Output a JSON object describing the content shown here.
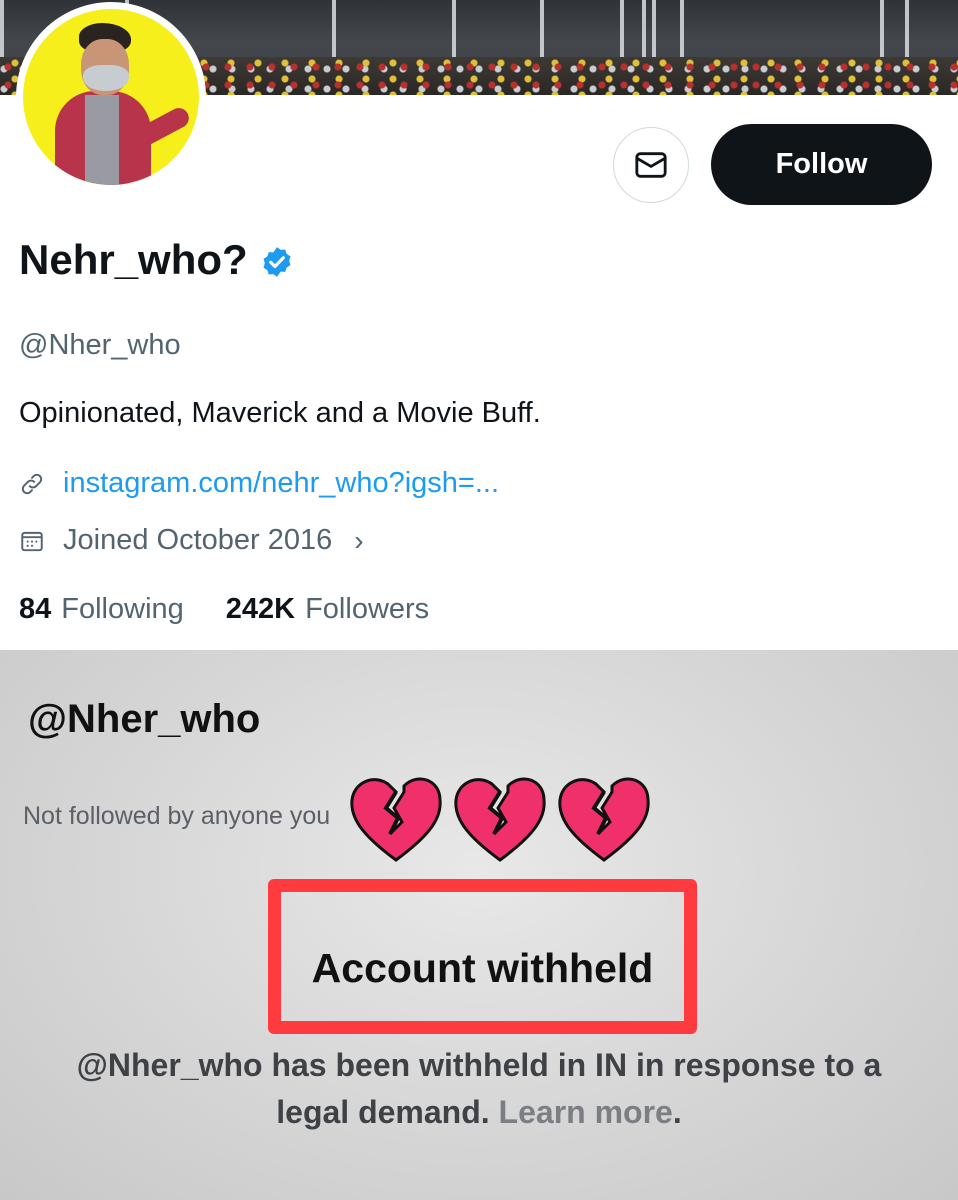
{
  "profile": {
    "display_name": "Nehr_who?",
    "handle": "@Nher_who",
    "bio": "Opinionated, Maverick and a Movie Buff.",
    "link": "instagram.com/nehr_who?igsh=...",
    "joined": "Joined October 2016",
    "following_count": "84",
    "following_label": "Following",
    "followers_count": "242K",
    "followers_label": "Followers",
    "verified": true
  },
  "actions": {
    "message_icon": "envelope-icon",
    "follow_label": "Follow"
  },
  "withheld": {
    "handle": "@Nher_who",
    "not_followed": "Not followed by anyone you",
    "title": "Account withheld",
    "description": "@Nher_who has been withheld in IN in response to a legal demand.",
    "learn_more": "Learn more",
    "trailing": ".",
    "overlay_emoji": [
      "broken-heart",
      "broken-heart",
      "broken-heart"
    ]
  },
  "colors": {
    "accent_link": "#1d9bf0",
    "follow_bg": "#0f1419",
    "verified": "#1d9bf0",
    "highlight": "#ff3b3f",
    "heart": "#f0306a"
  }
}
